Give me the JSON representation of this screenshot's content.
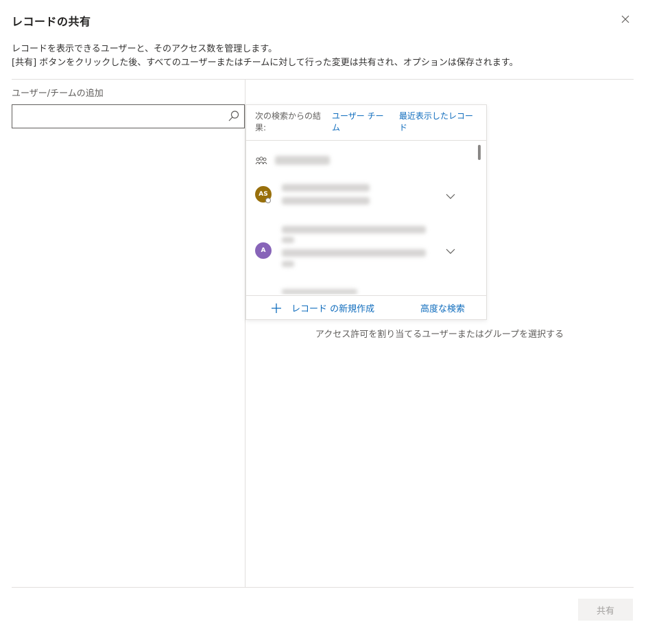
{
  "dialog": {
    "title": "レコードの共有",
    "description_line1": "レコードを表示できるユーザーと、そのアクセス数を管理します。",
    "description_line2": "[共有] ボタンをクリックした後、すべてのユーザーまたはチームに対して行った変更は共有され、オプションは保存されます。"
  },
  "left_panel": {
    "field_label": "ユーザー/チームの追加",
    "search": {
      "value": "",
      "placeholder": ""
    }
  },
  "dropdown": {
    "results_from_label": "次の検索からの結果:",
    "filter_users_teams": "ユーザー チーム",
    "filter_recent": "最近表示したレコード",
    "items": [
      {
        "type": "team",
        "icon": "team-icon"
      },
      {
        "type": "user",
        "initials": "AS",
        "avatar_color": "#986f0b",
        "has_presence": true
      },
      {
        "type": "user",
        "initials": "A",
        "avatar_color": "#8764b8",
        "has_presence": false
      }
    ],
    "new_record_label": "レコード の新規作成",
    "advanced_search_label": "高度な検索"
  },
  "right_panel": {
    "hint": "アクセス許可を割り当てるユーザーまたはグループを選択する"
  },
  "footer": {
    "share_label": "共有"
  },
  "colors": {
    "link": "#0f6cbd",
    "divider": "#e1dfdd",
    "disabled_button_bg": "#f3f2f1"
  }
}
